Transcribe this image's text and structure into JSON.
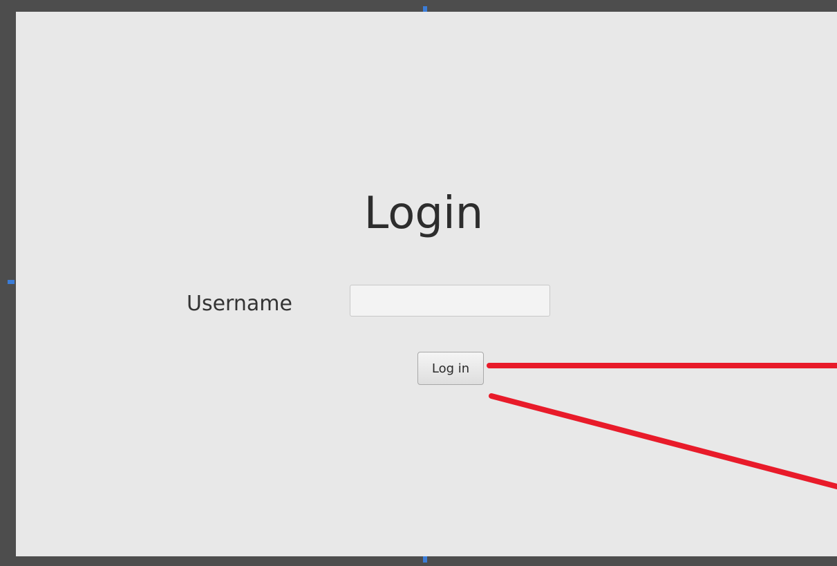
{
  "form": {
    "title": "Login",
    "username_label": "Username",
    "username_value": "",
    "login_button_label": "Log in"
  },
  "colors": {
    "frame": "#4d4d4d",
    "pane_background": "#e8e8e8",
    "annotation_lines": "#e81b2a",
    "selection_handles": "#3b7dd8"
  }
}
